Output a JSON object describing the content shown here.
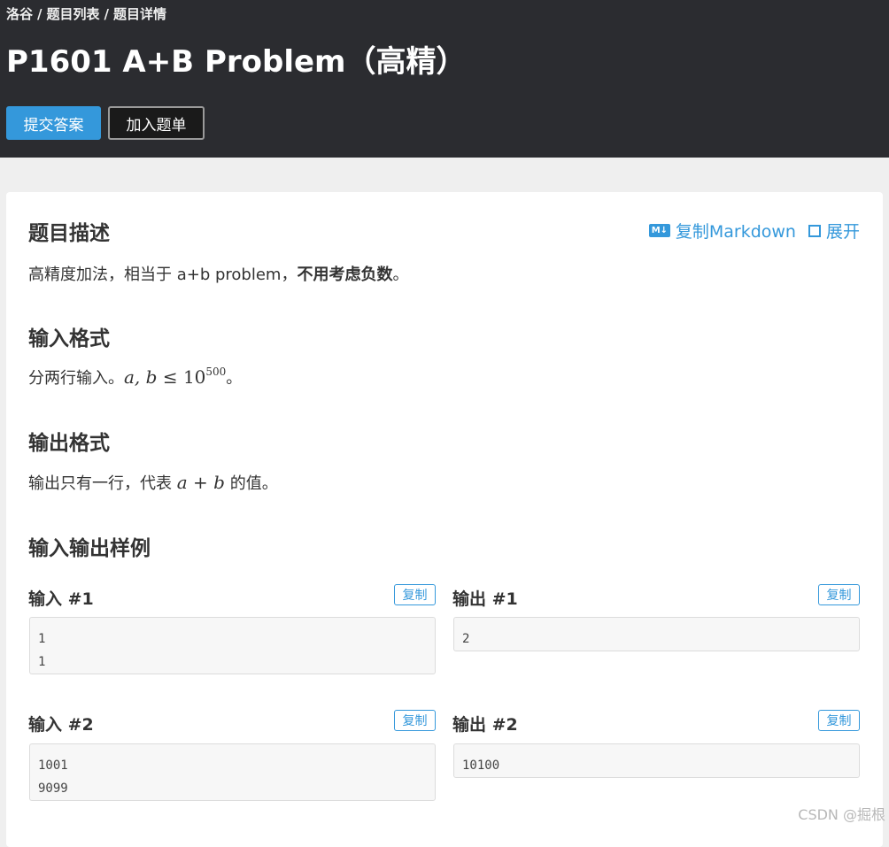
{
  "breadcrumb": {
    "items": [
      "洛谷",
      "题目列表",
      "题目详情"
    ],
    "separator": "/"
  },
  "problem": {
    "title": "P1601 A+B Problem（高精）"
  },
  "actions": {
    "submit_label": "提交答案",
    "add_label": "加入题单"
  },
  "toolbar": {
    "md_icon": "M↓",
    "copy_markdown_label": "复制Markdown",
    "expand_label": "展开"
  },
  "sections": {
    "description": {
      "heading": "题目描述",
      "text_prefix": "高精度加法，相当于 a+b problem，",
      "text_bold": "不用考虑负数",
      "text_suffix": "。"
    },
    "input_format": {
      "heading": "输入格式",
      "text_prefix": "分两行输入。",
      "math_vars": "a, b",
      "math_op": "≤",
      "math_base": "10",
      "math_exp": "500",
      "text_suffix": "。"
    },
    "output_format": {
      "heading": "输出格式",
      "text_prefix": "输出只有一行，代表 ",
      "math_a": "a",
      "math_plus": "+",
      "math_b": "b",
      "text_suffix": " 的值。"
    },
    "samples": {
      "heading": "输入输出样例",
      "copy_label": "复制",
      "items": [
        {
          "input_label": "输入 #1",
          "input": "1\n1",
          "output_label": "输出 #1",
          "output": "2"
        },
        {
          "input_label": "输入 #2",
          "input": "1001\n9099",
          "output_label": "输出 #2",
          "output": "10100"
        }
      ]
    }
  },
  "watermark": "CSDN @掘根",
  "colors": {
    "header_bg": "#2b2c30",
    "accent": "#3498db",
    "page_bg": "#efefef"
  }
}
